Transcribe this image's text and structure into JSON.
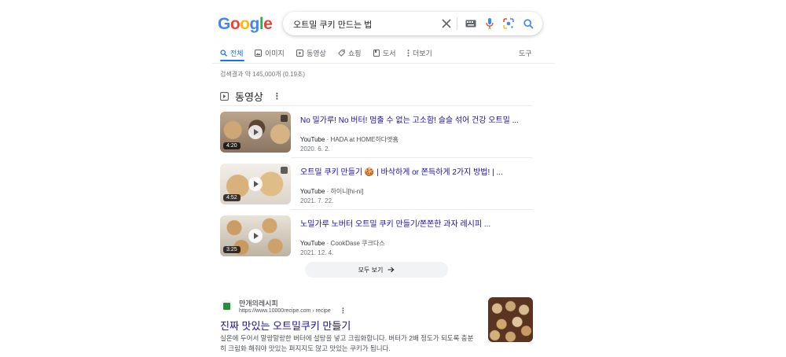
{
  "logo": {
    "letters": [
      "G",
      "o",
      "o",
      "g",
      "l",
      "e"
    ],
    "colors": [
      "#4285f4",
      "#ea4335",
      "#fbbc05",
      "#4285f4",
      "#34a853",
      "#ea4335"
    ]
  },
  "search": {
    "query": "오트밀 쿠키 만드는 법"
  },
  "icons": {
    "clear": "close-icon",
    "keyboard": "keyboard-icon",
    "voice": "mic-icon",
    "lens": "lens-icon",
    "search": "search-icon"
  },
  "tabs": {
    "items": [
      {
        "label": "전체",
        "icon": "search-icon",
        "active": true
      },
      {
        "label": "이미지",
        "icon": "image-icon"
      },
      {
        "label": "동영상",
        "icon": "play-icon"
      },
      {
        "label": "쇼핑",
        "icon": "tag-icon"
      },
      {
        "label": "도서",
        "icon": "book-icon"
      },
      {
        "label": "더보기",
        "icon": "more-vert-icon"
      }
    ],
    "tools": "도구"
  },
  "stats": "검색결과 약 145,000개 (0.19초)",
  "videos": {
    "heading": "동영상",
    "items": [
      {
        "title": "No 밀가루! No 버터! 멈출 수 없는 고소함! 슬슬 섞어 건강 오트밀 ...",
        "source": "YouTube",
        "channel": "HADA at HOME하다앳홈",
        "date": "2020. 6. 2.",
        "duration": "4:20"
      },
      {
        "title": "오트밀 쿠키 만들기 🍪 | 바삭하게 or 쫀득하게 2가지 방법! | ...",
        "source": "YouTube",
        "channel": "하이니[hi-ni]",
        "date": "2021. 7. 22.",
        "duration": "4:52"
      },
      {
        "title": "노밀가루 노버터 오트밀 쿠키 만들기/쫀쫀한 과자 레시피 ...",
        "source": "YouTube",
        "channel": "CookDase 쿠크다스",
        "date": "2021. 12. 4.",
        "duration": "3:25"
      }
    ],
    "see_all": "모두 보기"
  },
  "result": {
    "site": "만개의레시피",
    "url": "https://www.10000recipe.com › recipe",
    "title": "진짜 맛있는 오트밀쿠키 만들기",
    "snippet": "실온에 두어서 말랑말랑한 버터에 설탕을 넣고 크림화합니다. 버터가 2배 정도가 되도록 충분히 크림화 해줘야 맛있는 퍼지지도 않고 맛있는 쿠키가 됩니다."
  },
  "colors": {
    "accent": "#1a73e8",
    "link": "#1a0dab",
    "text": "#202124",
    "muted": "#70757a"
  }
}
